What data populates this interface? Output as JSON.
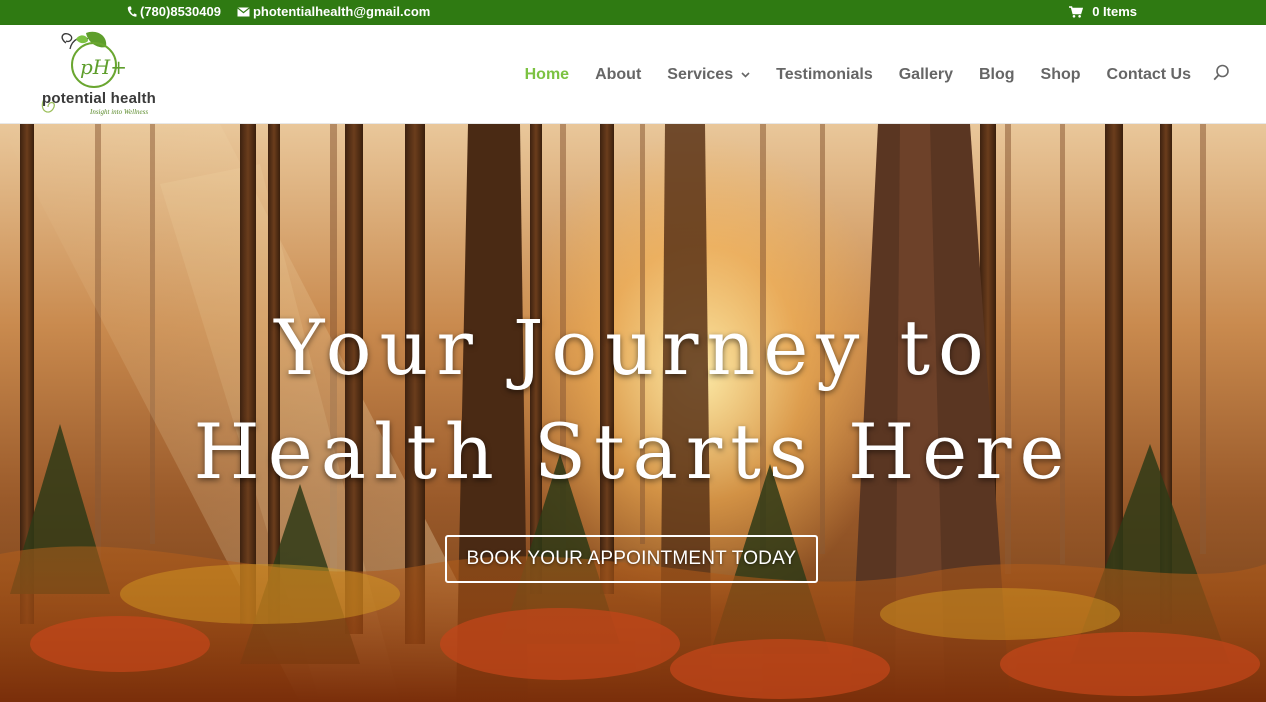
{
  "topbar": {
    "phone": "(780)8530409",
    "email": "photentialhealth@gmail.com",
    "cart_label": "0 Items",
    "background": "#2f7a12",
    "icons": {
      "phone": "phone-icon",
      "email": "envelope-icon",
      "cart": "cart-icon"
    }
  },
  "logo": {
    "text": "potential health",
    "tagline": "Insight into Wellness",
    "mark": "pH+"
  },
  "nav": {
    "items": [
      {
        "label": "Home",
        "active": true
      },
      {
        "label": "About"
      },
      {
        "label": "Services",
        "has_dropdown": true
      },
      {
        "label": "Testimonials"
      },
      {
        "label": "Gallery"
      },
      {
        "label": "Blog"
      },
      {
        "label": "Shop"
      },
      {
        "label": "Contact Us"
      }
    ],
    "active_color": "#7cc242",
    "search_icon": "search-icon"
  },
  "hero": {
    "title_line1": "Your Journey to",
    "title_line2": "Health Starts Here",
    "cta_label": "BOOK YOUR APPOINTMENT TODAY"
  }
}
